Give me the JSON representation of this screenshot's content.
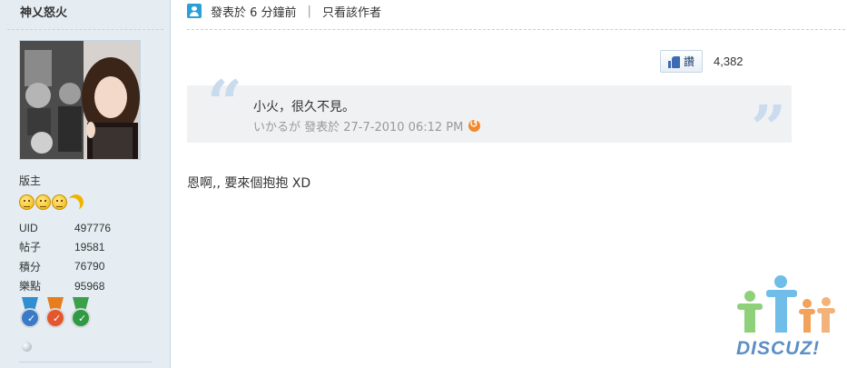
{
  "sidebar": {
    "username": "神乂怒火",
    "rank": "版主",
    "stats": [
      {
        "key": "UID",
        "value": "497776"
      },
      {
        "key": "帖子",
        "value": "19581"
      },
      {
        "key": "積分",
        "value": "76790"
      },
      {
        "key": "樂點",
        "value": "95968"
      }
    ],
    "level_icons": [
      "smiley-icon",
      "smiley-icon",
      "smiley-icon",
      "moon-icon"
    ],
    "medals": [
      {
        "icon": "medal-blue-icon",
        "ribbon": "#2f8fd0",
        "disc": "#3a7bc8"
      },
      {
        "icon": "medal-orange-icon",
        "ribbon": "#e87d1e",
        "disc": "#e4572e"
      },
      {
        "icon": "medal-green-icon",
        "ribbon": "#3aa04a",
        "disc": "#2f9a45"
      }
    ]
  },
  "post": {
    "posted_label": "發表於 6 分鐘前",
    "separator": "|",
    "only_author_label": "只看該作者",
    "like_label": "讚",
    "like_count": "4,382",
    "quote": {
      "text": "小火，很久不見。",
      "meta": "いかるが 發表於 27-7-2010 06:12 PM"
    },
    "body": "恩啊,, 要來個抱抱 XD"
  },
  "logo": {
    "text": "DISCUZ!"
  },
  "colors": {
    "sidebar_bg": "#e5edf2",
    "quote_bg": "#f0f1f3",
    "quote_mark": "#c8dcee",
    "logo_blue": "#5b8ec6"
  }
}
